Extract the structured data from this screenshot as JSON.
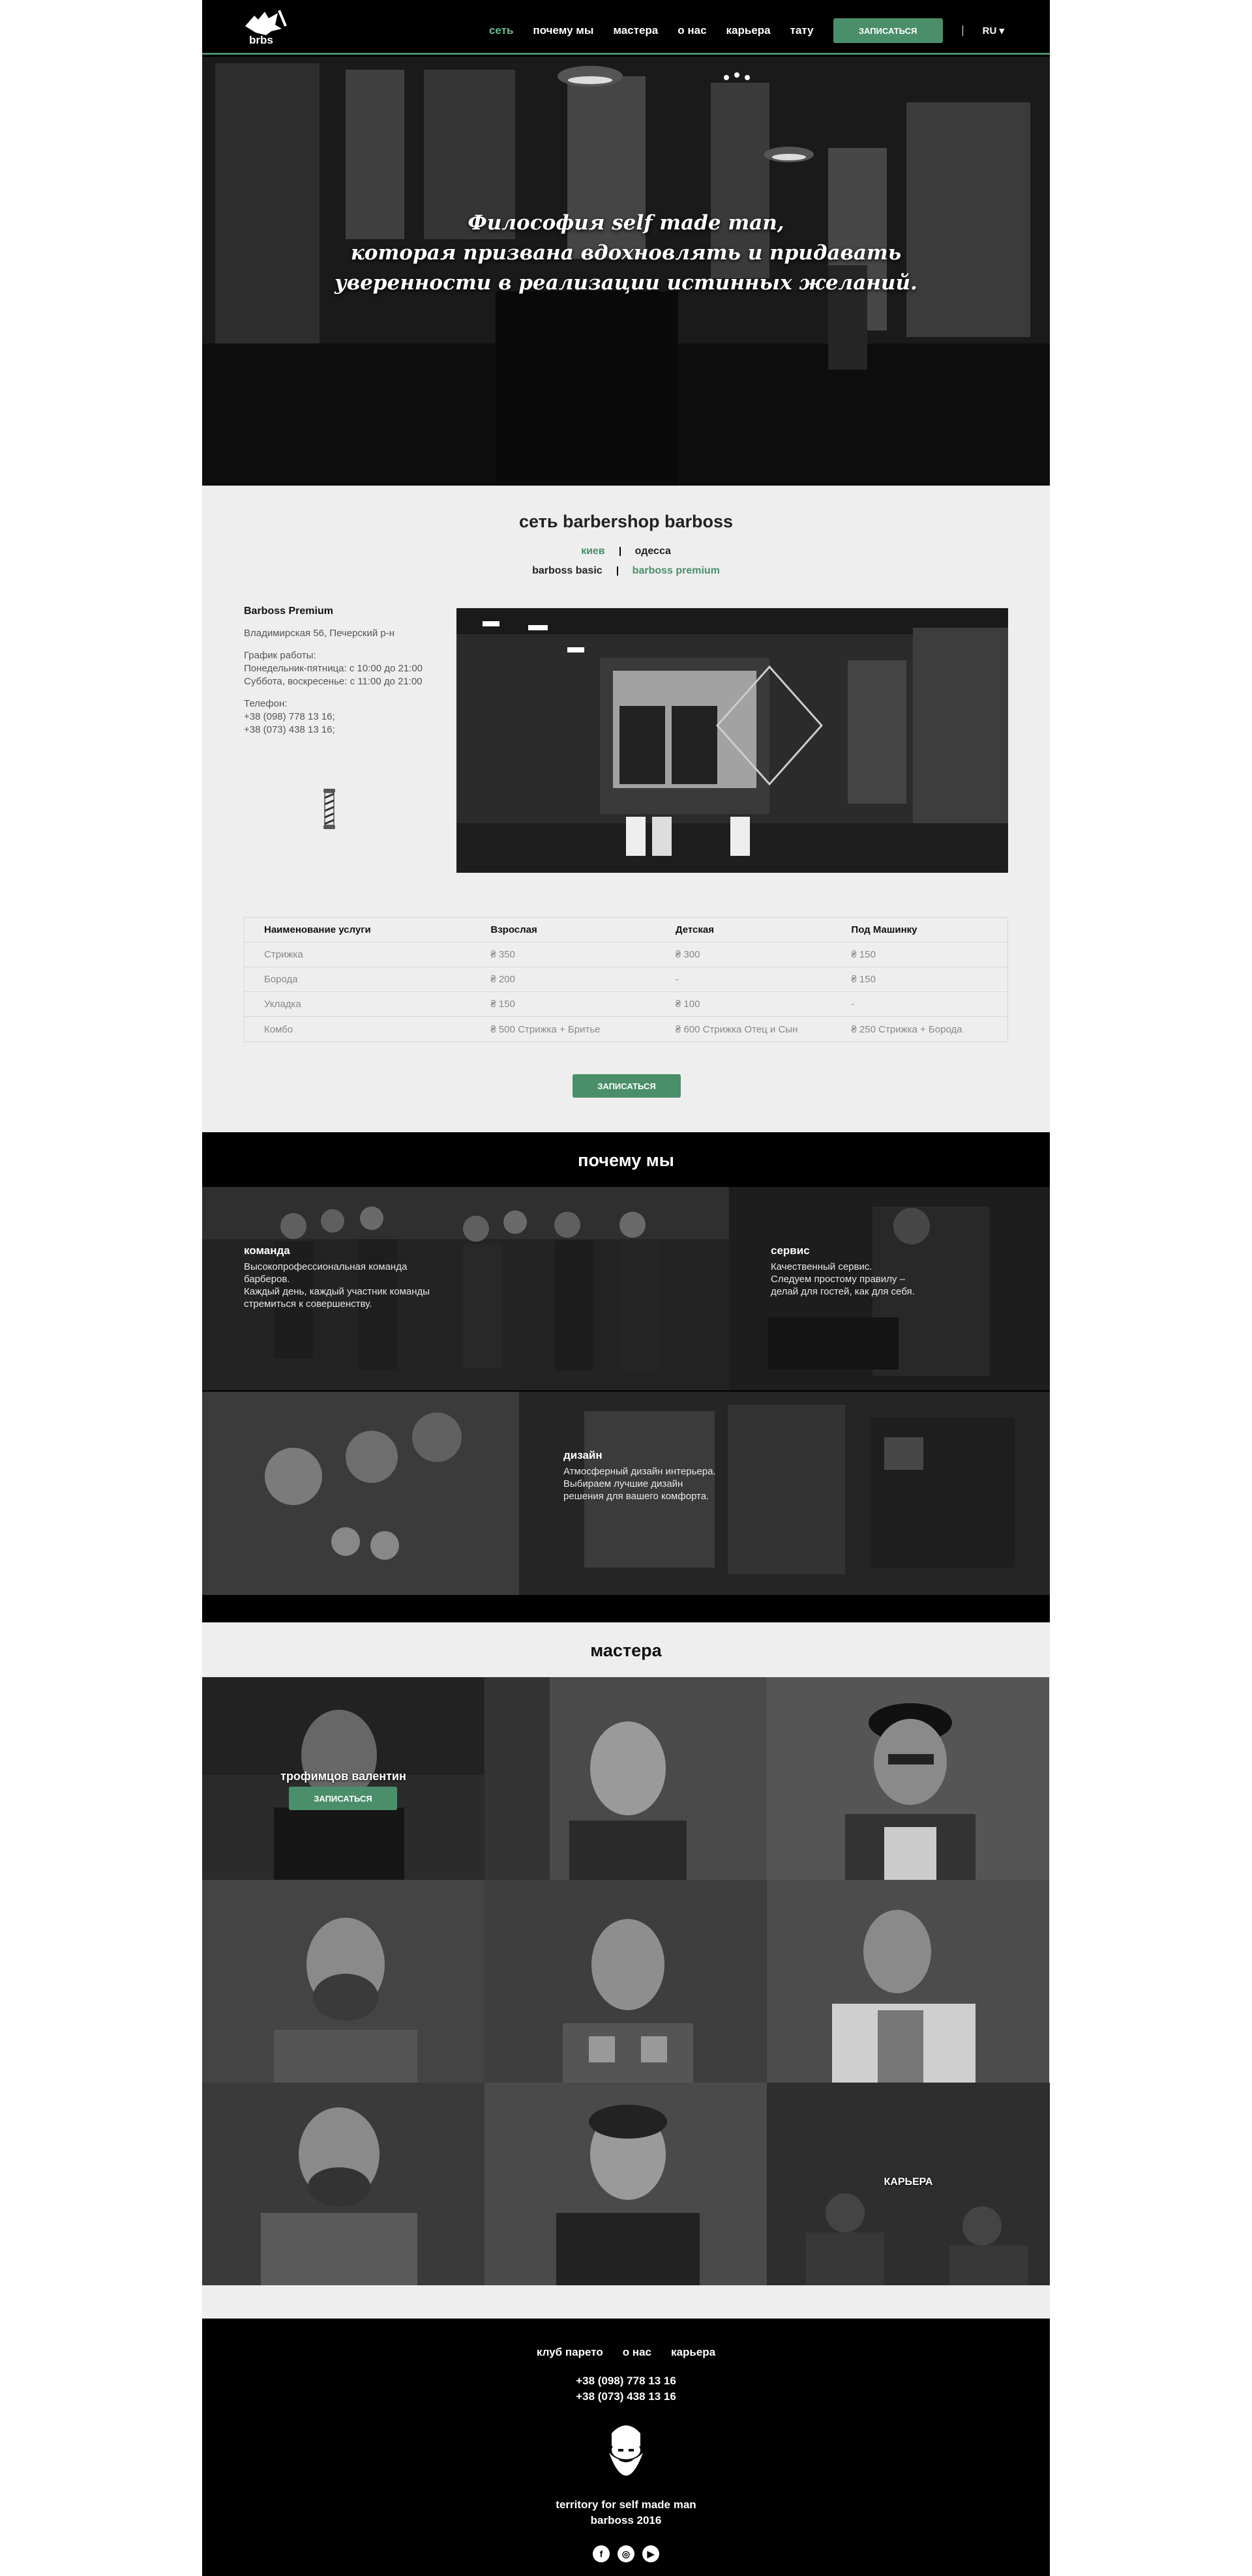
{
  "header": {
    "logo_text": "brbs",
    "nav": [
      "сеть",
      "почему мы",
      "мастера",
      "о нас",
      "карьера",
      "тату"
    ],
    "cta": "ЗАПИСАТЬСЯ",
    "lang": "RU ▾"
  },
  "hero": {
    "line1": "Философия self made man,",
    "line2": "которая призвана вдохновлять и придавать",
    "line3": "уверенности в реализации истинных желаний."
  },
  "network": {
    "title": "сеть barbershop barboss",
    "city_1": "киев",
    "city_2": "одесса",
    "shop_1": "barboss basic",
    "shop_2": "barboss premium",
    "shop_name": "Barboss Premium",
    "address": "Владимирская 56, Печерский р-н",
    "hours_title": "График работы:",
    "hours_1": "Понедельник-пятница: с 10:00 до 21:00",
    "hours_2": "Суббота, воскресенье: с 11:00 до 21:00",
    "phone_title": "Телефон:",
    "phone_1": "+38 (098) 778 13 16;",
    "phone_2": "+38 (073) 438 13 16;",
    "cta": "ЗАПИСАТЬСЯ",
    "price_head": [
      "Наименование услуги",
      "Взрослая",
      "Детская",
      "Под Машинку"
    ],
    "price_rows": [
      [
        "Стрижка",
        "₴ 350",
        "₴ 300",
        "₴ 150"
      ],
      [
        "Борода",
        "₴ 200",
        "-",
        "₴ 150"
      ],
      [
        "Укладка",
        "₴ 150",
        "₴ 100",
        "-"
      ],
      [
        "Комбо",
        "₴ 500 Стрижка + Бритье",
        "₴ 600 Стрижка Отец и Сын",
        "₴ 250 Стрижка + Борода"
      ]
    ]
  },
  "why": {
    "title": "почему мы",
    "team_title": "команда",
    "team_1": "Высокопрофессиональная команда",
    "team_2": "барберов.",
    "team_3": "Каждый день, каждый участник команды",
    "team_4": "стремиться к совершенству.",
    "service_title": "сервис",
    "service_1": "Качественный сервис.",
    "service_2": "Следуем простому правилу –",
    "service_3": "делай для гостей, как для себя.",
    "design_title": "дизайн",
    "design_1": "Атмосферный дизайн интерьера.",
    "design_2": "Выбираем лучшие дизайн",
    "design_3": "решения для вашего комфорта."
  },
  "masters": {
    "title": "мастера",
    "featured_name": "трофимцов валентин",
    "cta": "ЗАПИСАТЬСЯ",
    "career": "КАРЬЕРА"
  },
  "footer": {
    "link_1": "клуб парето",
    "link_2": "о нас",
    "link_3": "карьера",
    "phone_1": "+38 (098) 778 13 16",
    "phone_2": "+38 (073) 438 13 16",
    "tagline": "territory for self made man",
    "year": "barboss 2016",
    "social": [
      "f",
      "◎",
      "▶"
    ]
  },
  "colors": {
    "accent": "#4a8f6a",
    "accent_light": "#6dbd8d",
    "bg_light": "#eeeeee",
    "bg_dark": "#000000"
  }
}
